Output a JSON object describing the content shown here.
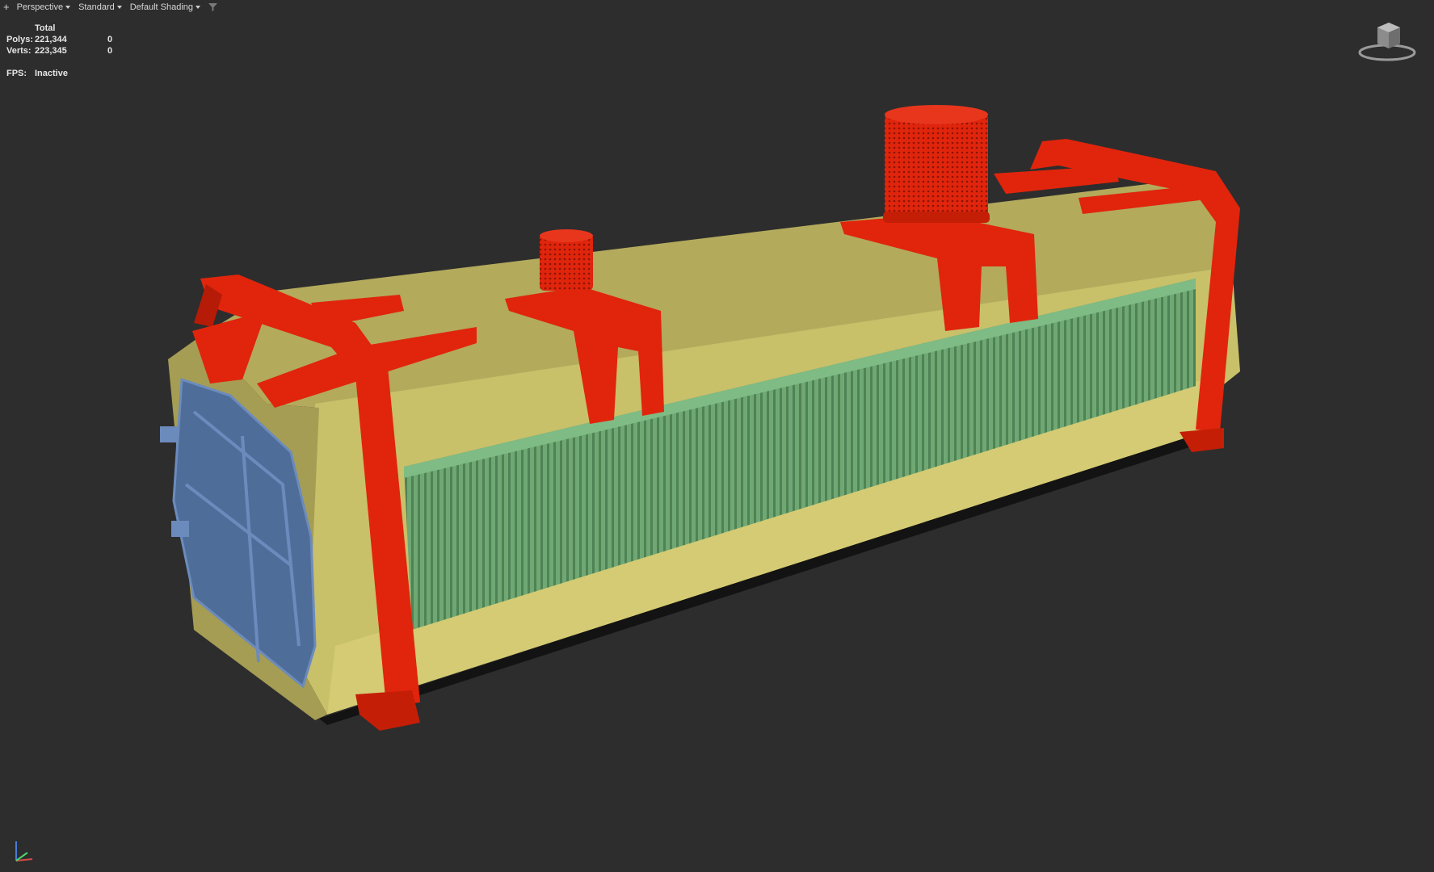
{
  "toolbar": {
    "plus_label": "+",
    "view_label": "Perspective",
    "style_label": "Standard",
    "shading_label": "Default Shading"
  },
  "stats": {
    "header": "Total",
    "polys_label": "Polys:",
    "polys_total": "221,344",
    "polys_selected": "0",
    "verts_label": "Verts:",
    "verts_total": "223,345",
    "verts_selected": "0",
    "fps_label": "FPS:",
    "fps_value": "Inactive"
  },
  "icons": {
    "filter": "filter-icon",
    "viewcube": "viewcube-icon",
    "axis": "axis-tripod-icon"
  },
  "colors": {
    "background": "#2d2d2d",
    "body_yellow": "#c9c06a",
    "frame_red": "#e0250c",
    "fins_green": "#6fa873",
    "panel_blue": "#5a7ba8"
  }
}
